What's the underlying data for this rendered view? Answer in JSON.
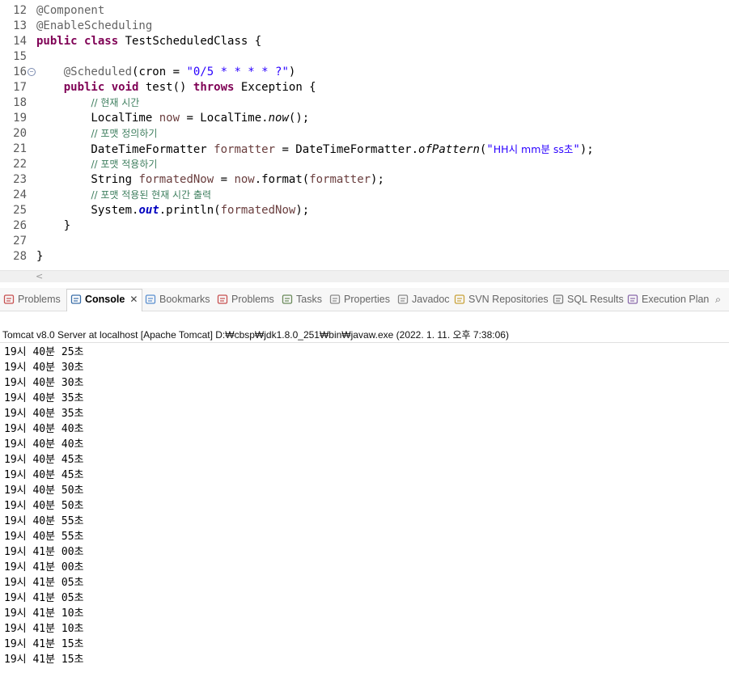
{
  "editor": {
    "lines": [
      {
        "n": "12",
        "html": "<span class=\"ann\">@Component</span>"
      },
      {
        "n": "13",
        "html": "<span class=\"ann\">@EnableScheduling</span>"
      },
      {
        "n": "14",
        "html": "<span class=\"kw\">public</span> <span class=\"kw\">class</span> TestScheduledClass {"
      },
      {
        "n": "15",
        "html": ""
      },
      {
        "n": "16",
        "html": "    <span class=\"ann\">@Scheduled</span>(cron = <span class=\"str\">\"0/5 * * * * ?\"</span>)",
        "fold": true
      },
      {
        "n": "17",
        "html": "    <span class=\"kw\">public</span> <span class=\"kw\">void</span> test() <span class=\"kw\">throws</span> Exception {"
      },
      {
        "n": "18",
        "html": "        <span class=\"cmt\">// 현재 시간</span>"
      },
      {
        "n": "19",
        "html": "        LocalTime <span class=\"var\">now</span> = LocalTime.<span class=\"ital\">now</span>();"
      },
      {
        "n": "20",
        "html": "        <span class=\"cmt\">// 포맷 정의하기</span>"
      },
      {
        "n": "21",
        "html": "        DateTimeFormatter <span class=\"var\">formatter</span> = DateTimeFormatter.<span class=\"ital\">ofPattern</span>(<span class=\"str\">\"<span class=\"kstr\">HH시 mm분 ss초</span>\"</span>);"
      },
      {
        "n": "22",
        "html": "        <span class=\"cmt\">// 포맷 적용하기</span>"
      },
      {
        "n": "23",
        "html": "        String <span class=\"var\">formatedNow</span> = <span class=\"var\">now</span>.format(<span class=\"var\">formatter</span>);"
      },
      {
        "n": "24",
        "html": "        <span class=\"cmt\">// 포맷 적용된 현재 시간 출력</span>"
      },
      {
        "n": "25",
        "html": "        System.<span class=\"field\">out</span>.println(<span class=\"var\">formatedNow</span>);"
      },
      {
        "n": "26",
        "html": "    }"
      },
      {
        "n": "27",
        "html": ""
      },
      {
        "n": "28",
        "html": "}"
      }
    ]
  },
  "tabs": [
    {
      "label": "Problems",
      "icon": "problems-icon"
    },
    {
      "label": "Console",
      "icon": "console-icon",
      "active": true
    },
    {
      "label": "Bookmarks",
      "icon": "bookmarks-icon"
    },
    {
      "label": "Problems",
      "icon": "problems-icon"
    },
    {
      "label": "Tasks",
      "icon": "tasks-icon"
    },
    {
      "label": "Properties",
      "icon": "properties-icon"
    },
    {
      "label": "Javadoc",
      "icon": "javadoc-icon"
    },
    {
      "label": "SVN Repositories",
      "icon": "svn-icon"
    },
    {
      "label": "SQL Results",
      "icon": "sql-results-icon"
    },
    {
      "label": "Execution Plan",
      "icon": "execution-plan-icon"
    }
  ],
  "console": {
    "header": "Tomcat v8.0 Server at localhost [Apache Tomcat] D:₩cbsp₩jdk1.8.0_251₩bin₩javaw.exe (2022. 1. 11. 오후 7:38:06)",
    "lines": [
      "19시 40분 25초",
      "19시 40분 30초",
      "19시 40분 30초",
      "19시 40분 35초",
      "19시 40분 35초",
      "19시 40분 40초",
      "19시 40분 40초",
      "19시 40분 45초",
      "19시 40분 45초",
      "19시 40분 50초",
      "19시 40분 50초",
      "19시 40분 55초",
      "19시 40분 55초",
      "19시 41분 00초",
      "19시 41분 00초",
      "19시 41분 05초",
      "19시 41분 05초",
      "19시 41분 10초",
      "19시 41분 10초",
      "19시 41분 15초",
      "19시 41분 15초"
    ]
  }
}
